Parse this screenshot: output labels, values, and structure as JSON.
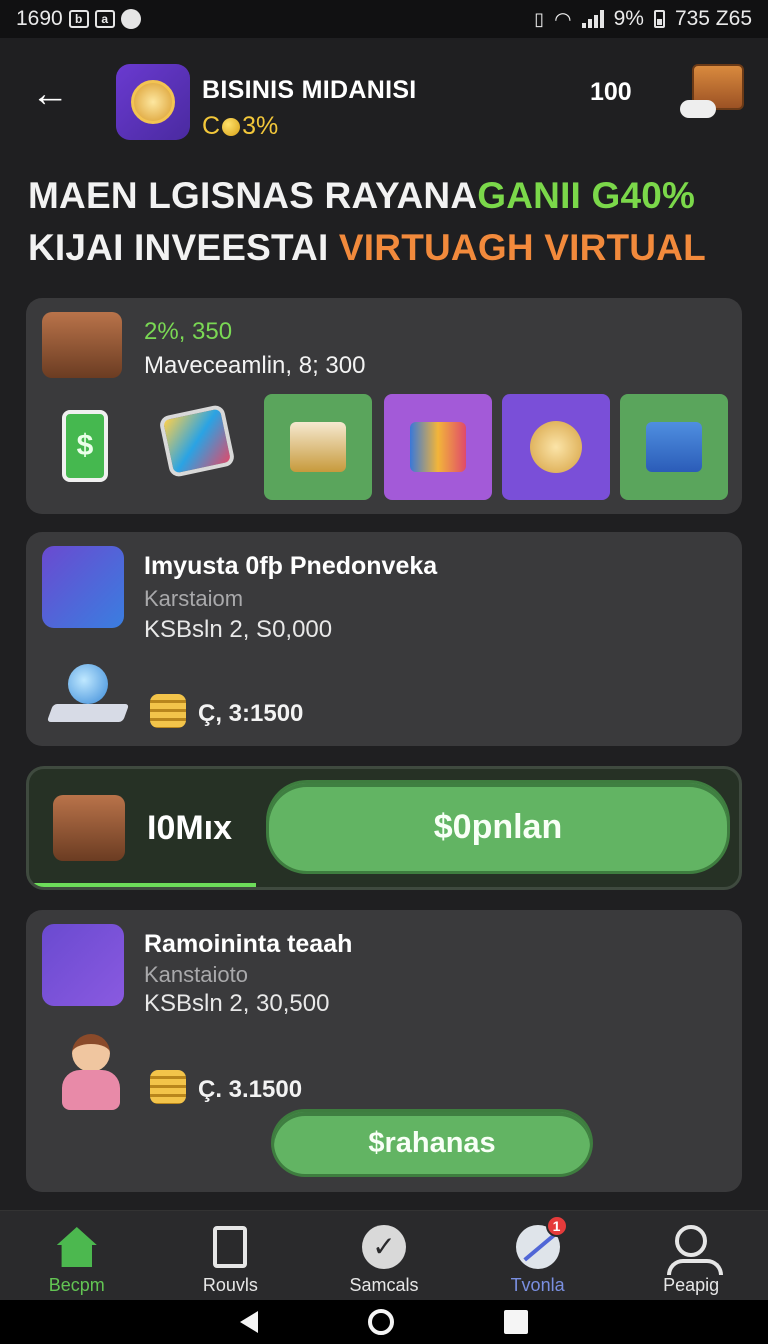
{
  "status_bar": {
    "left_text": "1690",
    "right_battery": "9%",
    "right_time": "735 Z65"
  },
  "header": {
    "title": "BISINIS MIDANISI",
    "subtitle_prefix": "C",
    "subtitle_value": "3%",
    "count": "100"
  },
  "headline": {
    "line1_white": "MAEN LGISNAS RAYANA",
    "line1_green": "GANII G40%",
    "line2_white": "KIJAI INVEESTAI ",
    "line2_orange": "VIRTUAGH VIRTUAL"
  },
  "card1": {
    "green_line": "2%, 350",
    "white_line": "Maveceamlin, 8; 300"
  },
  "card2": {
    "title": "Imyusta 0fþ Pnedonveka",
    "subtitle": "Karstaiom",
    "detail": "KSBsln 2, S0,000",
    "coin_value": "Ç, 3:1500"
  },
  "promo": {
    "label": "I0Mıx",
    "button": "$0pnlan",
    "progress": 0.32
  },
  "card3": {
    "title": "Ramoininta teaah",
    "subtitle": "Kanstaioto",
    "detail": "KSBsln 2, 30,500",
    "coin_value": "Ç. 3.1500",
    "button": "$rahanas"
  },
  "bottom_nav": [
    {
      "label": "Becpm",
      "icon": "home-icon",
      "active": true
    },
    {
      "label": "Rouvls",
      "icon": "document-icon"
    },
    {
      "label": "Samcals",
      "icon": "check-icon"
    },
    {
      "label": "Tvonla",
      "icon": "globe-icon",
      "badge": "1"
    },
    {
      "label": "Peapig",
      "icon": "profile-icon"
    }
  ],
  "colors": {
    "accent_green": "#62b463",
    "headline_green": "#7bd84a",
    "headline_orange": "#f28a3c",
    "coin_gold": "#f2c73a"
  }
}
